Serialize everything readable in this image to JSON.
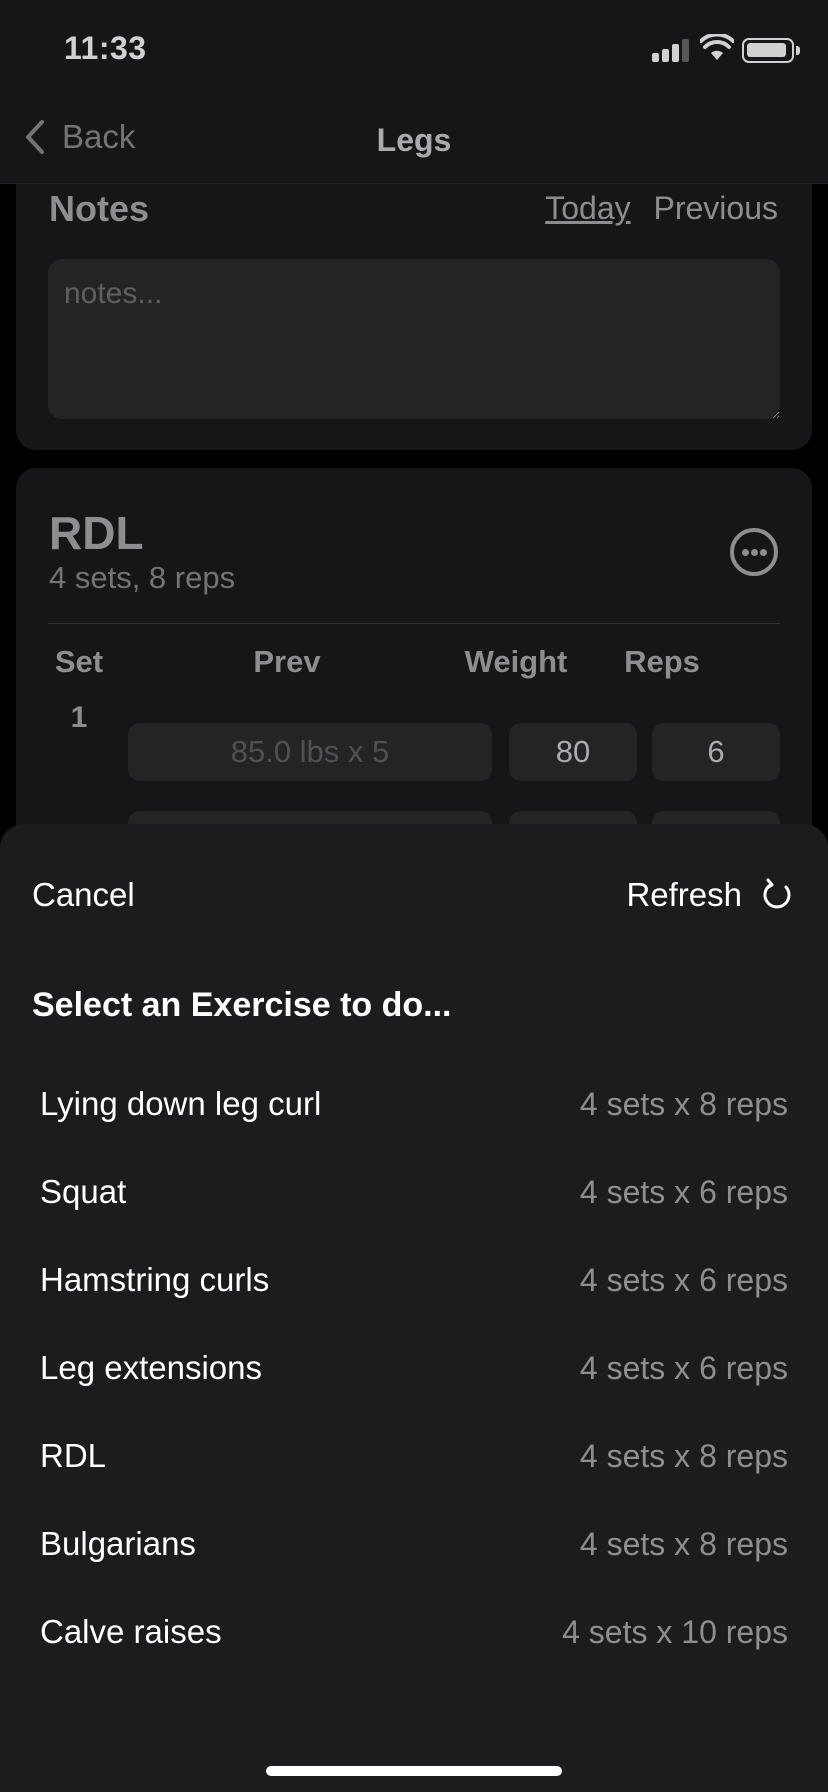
{
  "status": {
    "time": "11:33"
  },
  "nav": {
    "back_label": "Back",
    "title": "Legs"
  },
  "notes": {
    "title": "Notes",
    "tab_today": "Today",
    "tab_previous": "Previous",
    "placeholder": "notes..."
  },
  "exercise": {
    "name": "RDL",
    "summary": "4 sets, 8 reps",
    "columns": {
      "set": "Set",
      "prev": "Prev",
      "weight": "Weight",
      "reps": "Reps"
    },
    "sets": [
      {
        "set": "1",
        "prev": "85.0 lbs x 5",
        "weight": "80",
        "reps": "6"
      }
    ]
  },
  "sheet": {
    "cancel_label": "Cancel",
    "refresh_label": "Refresh",
    "title": "Select an Exercise to do...",
    "items": [
      {
        "name": "Lying down leg curl",
        "detail": "4 sets x 8 reps"
      },
      {
        "name": "Squat",
        "detail": "4 sets x 6 reps"
      },
      {
        "name": "Hamstring curls",
        "detail": "4 sets x 6 reps"
      },
      {
        "name": "Leg extensions",
        "detail": "4 sets x 6 reps"
      },
      {
        "name": "RDL",
        "detail": "4 sets x 8 reps"
      },
      {
        "name": "Bulgarians",
        "detail": "4 sets x 8 reps"
      },
      {
        "name": "Calve raises",
        "detail": "4 sets x 10 reps"
      }
    ]
  },
  "colors": {
    "background": "#000000",
    "surface": "#1c1c1e",
    "field": "#2c2c2e",
    "secondary_text": "#8e8e93"
  }
}
